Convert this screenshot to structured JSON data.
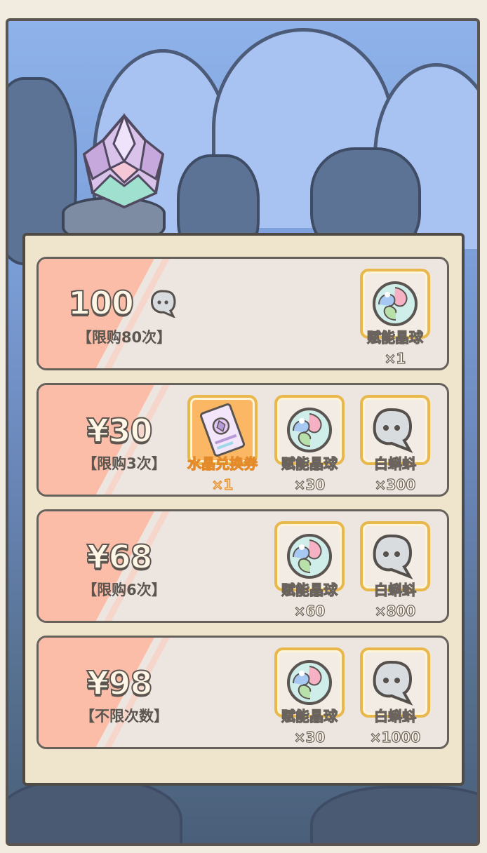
{
  "offers": [
    {
      "price": "100",
      "limit": "【限购80次】",
      "currency_icon": "white-tadpole-icon",
      "rewards": [
        {
          "icon": "empower-orb-icon",
          "name": "赋能晶球",
          "qty": "×1"
        }
      ]
    },
    {
      "price": "¥30",
      "limit": "【限购3次】",
      "rewards": [
        {
          "icon": "crystal-voucher-icon",
          "name": "水晶兑换券",
          "qty": "×1"
        },
        {
          "icon": "empower-orb-icon",
          "name": "赋能晶球",
          "qty": "×30"
        },
        {
          "icon": "white-tadpole-icon",
          "name": "白蝌蚪",
          "qty": "×300"
        }
      ]
    },
    {
      "price": "¥68",
      "limit": "【限购6次】",
      "rewards": [
        {
          "icon": "empower-orb-icon",
          "name": "赋能晶球",
          "qty": "×60"
        },
        {
          "icon": "white-tadpole-icon",
          "name": "白蝌蚪",
          "qty": "×800"
        }
      ]
    },
    {
      "price": "¥98",
      "limit": "【不限次数】",
      "rewards": [
        {
          "icon": "empower-orb-icon",
          "name": "赋能晶球",
          "qty": "×30"
        },
        {
          "icon": "white-tadpole-icon",
          "name": "白蝌蚪",
          "qty": "×1000"
        }
      ]
    }
  ],
  "colors": {
    "stripe": "#fbbda7",
    "card": "#ede5df",
    "panel": "#efe4cc",
    "item_border": "#e9b84d",
    "voucher_bg": "#fbb763"
  }
}
